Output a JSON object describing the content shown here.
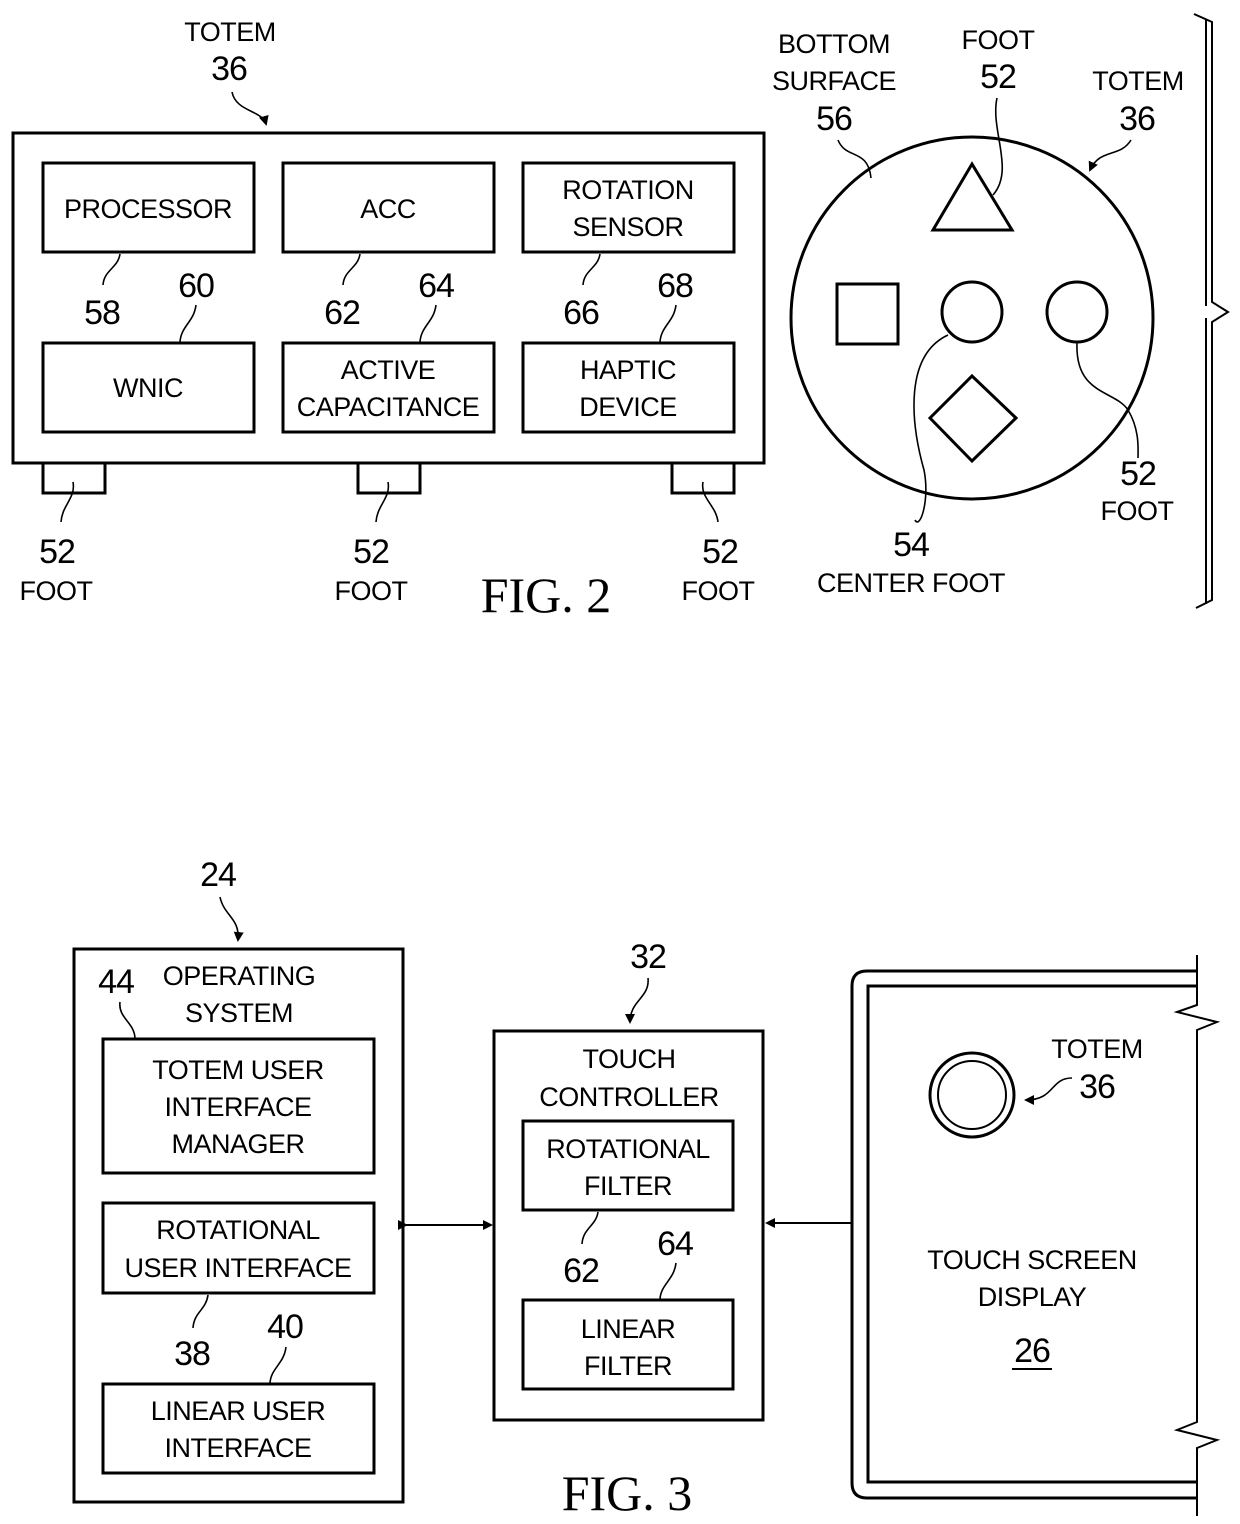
{
  "fig2": {
    "caption": "FIG. 2",
    "side_view": {
      "totem_label": "TOTEM",
      "totem_ref": "36",
      "components": [
        {
          "lines": [
            "PROCESSOR"
          ],
          "ref": "58"
        },
        {
          "lines": [
            "ACC"
          ],
          "ref": "62"
        },
        {
          "lines": [
            "ROTATION",
            "SENSOR"
          ],
          "ref": "66"
        },
        {
          "lines": [
            "WNIC"
          ],
          "ref": "60"
        },
        {
          "lines": [
            "ACTIVE",
            "CAPACITANCE"
          ],
          "ref": "64"
        },
        {
          "lines": [
            "HAPTIC",
            "DEVICE"
          ],
          "ref": "68"
        }
      ],
      "feet": [
        {
          "ref": "52",
          "label": "FOOT"
        },
        {
          "ref": "52",
          "label": "FOOT"
        },
        {
          "ref": "52",
          "label": "FOOT"
        }
      ]
    },
    "bottom_view": {
      "surface_label": [
        "BOTTOM",
        "SURFACE"
      ],
      "surface_ref": "56",
      "top_foot_label": "FOOT",
      "top_foot_ref": "52",
      "totem_label": "TOTEM",
      "totem_ref": "36",
      "right_foot_ref": "52",
      "right_foot_label": "FOOT",
      "center_foot_ref": "54",
      "center_foot_label": "CENTER FOOT"
    }
  },
  "fig3": {
    "caption": "FIG. 3",
    "os": {
      "ref": "24",
      "title": [
        "OPERATING",
        "SYSTEM"
      ],
      "modules": [
        {
          "lines": [
            "TOTEM USER",
            "INTERFACE",
            "MANAGER"
          ],
          "ref": "44"
        },
        {
          "lines": [
            "ROTATIONAL",
            "USER INTERFACE"
          ],
          "ref": "38"
        },
        {
          "lines": [
            "LINEAR USER",
            "INTERFACE"
          ],
          "ref": "40"
        }
      ]
    },
    "touch_controller": {
      "ref": "32",
      "title": [
        "TOUCH",
        "CONTROLLER"
      ],
      "filters": [
        {
          "lines": [
            "ROTATIONAL",
            "FILTER"
          ],
          "ref": "62"
        },
        {
          "lines": [
            "LINEAR",
            "FILTER"
          ],
          "ref": "64"
        }
      ]
    },
    "display": {
      "title": [
        "TOUCH SCREEN",
        "DISPLAY"
      ],
      "ref": "26",
      "totem_label": "TOTEM",
      "totem_ref": "36"
    }
  }
}
